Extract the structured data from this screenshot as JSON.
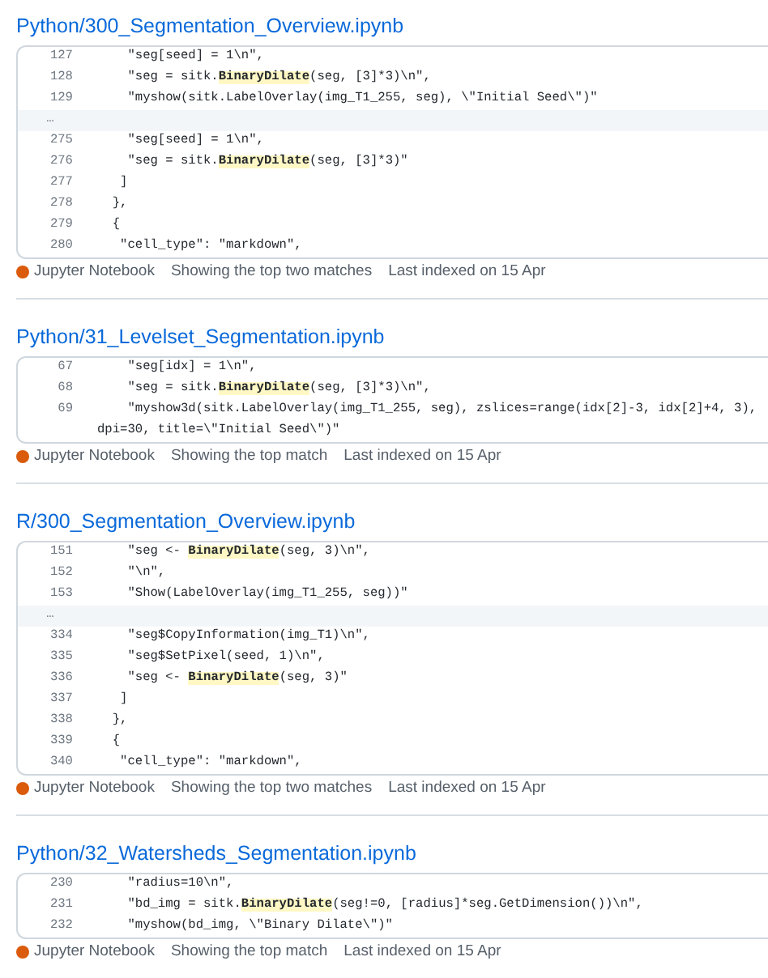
{
  "results": [
    {
      "path": "Python/300_Segmentation_Overview.ipynb",
      "rows": [
        {
          "kind": "line",
          "number": "127",
          "parts": [
            {
              "text": "    \"seg[seed] = 1\\n\",",
              "match": false
            }
          ]
        },
        {
          "kind": "line",
          "number": "128",
          "parts": [
            {
              "text": "    \"seg = sitk.",
              "match": false
            },
            {
              "text": "BinaryDilate",
              "match": true
            },
            {
              "text": "(seg, [3]*3)\\n\",",
              "match": false
            }
          ]
        },
        {
          "kind": "line",
          "number": "129",
          "parts": [
            {
              "text": "    \"myshow(sitk.LabelOverlay(img_T1_255, seg), \\\"Initial Seed\\\")\"",
              "match": false
            }
          ]
        },
        {
          "kind": "gap",
          "number": "…"
        },
        {
          "kind": "line",
          "number": "275",
          "parts": [
            {
              "text": "    \"seg[seed] = 1\\n\",",
              "match": false
            }
          ]
        },
        {
          "kind": "line",
          "number": "276",
          "parts": [
            {
              "text": "    \"seg = sitk.",
              "match": false
            },
            {
              "text": "BinaryDilate",
              "match": true
            },
            {
              "text": "(seg, [3]*3)\"",
              "match": false
            }
          ]
        },
        {
          "kind": "line",
          "number": "277",
          "parts": [
            {
              "text": "   ]",
              "match": false
            }
          ]
        },
        {
          "kind": "line",
          "number": "278",
          "parts": [
            {
              "text": "  },",
              "match": false
            }
          ]
        },
        {
          "kind": "line",
          "number": "279",
          "parts": [
            {
              "text": "  {",
              "match": false
            }
          ]
        },
        {
          "kind": "line",
          "number": "280",
          "parts": [
            {
              "text": "   \"cell_type\": \"markdown\",",
              "match": false
            }
          ]
        }
      ],
      "footer": {
        "language": "Jupyter Notebook",
        "color": "#da5b0b",
        "matches": "Showing the top two matches",
        "indexed": "Last indexed on 15 Apr"
      }
    },
    {
      "path": "Python/31_Levelset_Segmentation.ipynb",
      "rows": [
        {
          "kind": "line",
          "number": "67",
          "parts": [
            {
              "text": "    \"seg[idx] = 1\\n\",",
              "match": false
            }
          ]
        },
        {
          "kind": "line",
          "number": "68",
          "parts": [
            {
              "text": "    \"seg = sitk.",
              "match": false
            },
            {
              "text": "BinaryDilate",
              "match": true
            },
            {
              "text": "(seg, [3]*3)\\n\",",
              "match": false
            }
          ]
        },
        {
          "kind": "line",
          "number": "69",
          "parts": [
            {
              "text": "    \"myshow3d(sitk.LabelOverlay(img_T1_255, seg), zslices=range(idx[2]-3, idx[2]+4, 3), dpi=30, title=\\\"Initial Seed\\\")\"",
              "match": false
            }
          ]
        }
      ],
      "footer": {
        "language": "Jupyter Notebook",
        "color": "#da5b0b",
        "matches": "Showing the top match",
        "indexed": "Last indexed on 15 Apr"
      }
    },
    {
      "path": "R/300_Segmentation_Overview.ipynb",
      "rows": [
        {
          "kind": "line",
          "number": "151",
          "parts": [
            {
              "text": "    \"seg <- ",
              "match": false
            },
            {
              "text": "BinaryDilate",
              "match": true
            },
            {
              "text": "(seg, 3)\\n\",",
              "match": false
            }
          ]
        },
        {
          "kind": "line",
          "number": "152",
          "parts": [
            {
              "text": "    \"\\n\",",
              "match": false
            }
          ]
        },
        {
          "kind": "line",
          "number": "153",
          "parts": [
            {
              "text": "    \"Show(LabelOverlay(img_T1_255, seg))\"",
              "match": false
            }
          ]
        },
        {
          "kind": "gap",
          "number": "…"
        },
        {
          "kind": "line",
          "number": "334",
          "parts": [
            {
              "text": "    \"seg$CopyInformation(img_T1)\\n\",",
              "match": false
            }
          ]
        },
        {
          "kind": "line",
          "number": "335",
          "parts": [
            {
              "text": "    \"seg$SetPixel(seed, 1)\\n\",",
              "match": false
            }
          ]
        },
        {
          "kind": "line",
          "number": "336",
          "parts": [
            {
              "text": "    \"seg <- ",
              "match": false
            },
            {
              "text": "BinaryDilate",
              "match": true
            },
            {
              "text": "(seg, 3)\"",
              "match": false
            }
          ]
        },
        {
          "kind": "line",
          "number": "337",
          "parts": [
            {
              "text": "   ]",
              "match": false
            }
          ]
        },
        {
          "kind": "line",
          "number": "338",
          "parts": [
            {
              "text": "  },",
              "match": false
            }
          ]
        },
        {
          "kind": "line",
          "number": "339",
          "parts": [
            {
              "text": "  {",
              "match": false
            }
          ]
        },
        {
          "kind": "line",
          "number": "340",
          "parts": [
            {
              "text": "   \"cell_type\": \"markdown\",",
              "match": false
            }
          ]
        }
      ],
      "footer": {
        "language": "Jupyter Notebook",
        "color": "#da5b0b",
        "matches": "Showing the top two matches",
        "indexed": "Last indexed on 15 Apr"
      }
    },
    {
      "path": "Python/32_Watersheds_Segmentation.ipynb",
      "rows": [
        {
          "kind": "line",
          "number": "230",
          "parts": [
            {
              "text": "    \"radius=10\\n\",",
              "match": false
            }
          ]
        },
        {
          "kind": "line",
          "number": "231",
          "parts": [
            {
              "text": "    \"bd_img = sitk.",
              "match": false
            },
            {
              "text": "BinaryDilate",
              "match": true
            },
            {
              "text": "(seg!=0, [radius]*seg.GetDimension())\\n\",",
              "match": false
            }
          ]
        },
        {
          "kind": "line",
          "number": "232",
          "parts": [
            {
              "text": "    \"myshow(bd_img, \\\"Binary Dilate\\\")\"",
              "match": false
            }
          ]
        }
      ],
      "footer": {
        "language": "Jupyter Notebook",
        "color": "#da5b0b",
        "matches": "Showing the top match",
        "indexed": "Last indexed on 15 Apr"
      }
    }
  ]
}
